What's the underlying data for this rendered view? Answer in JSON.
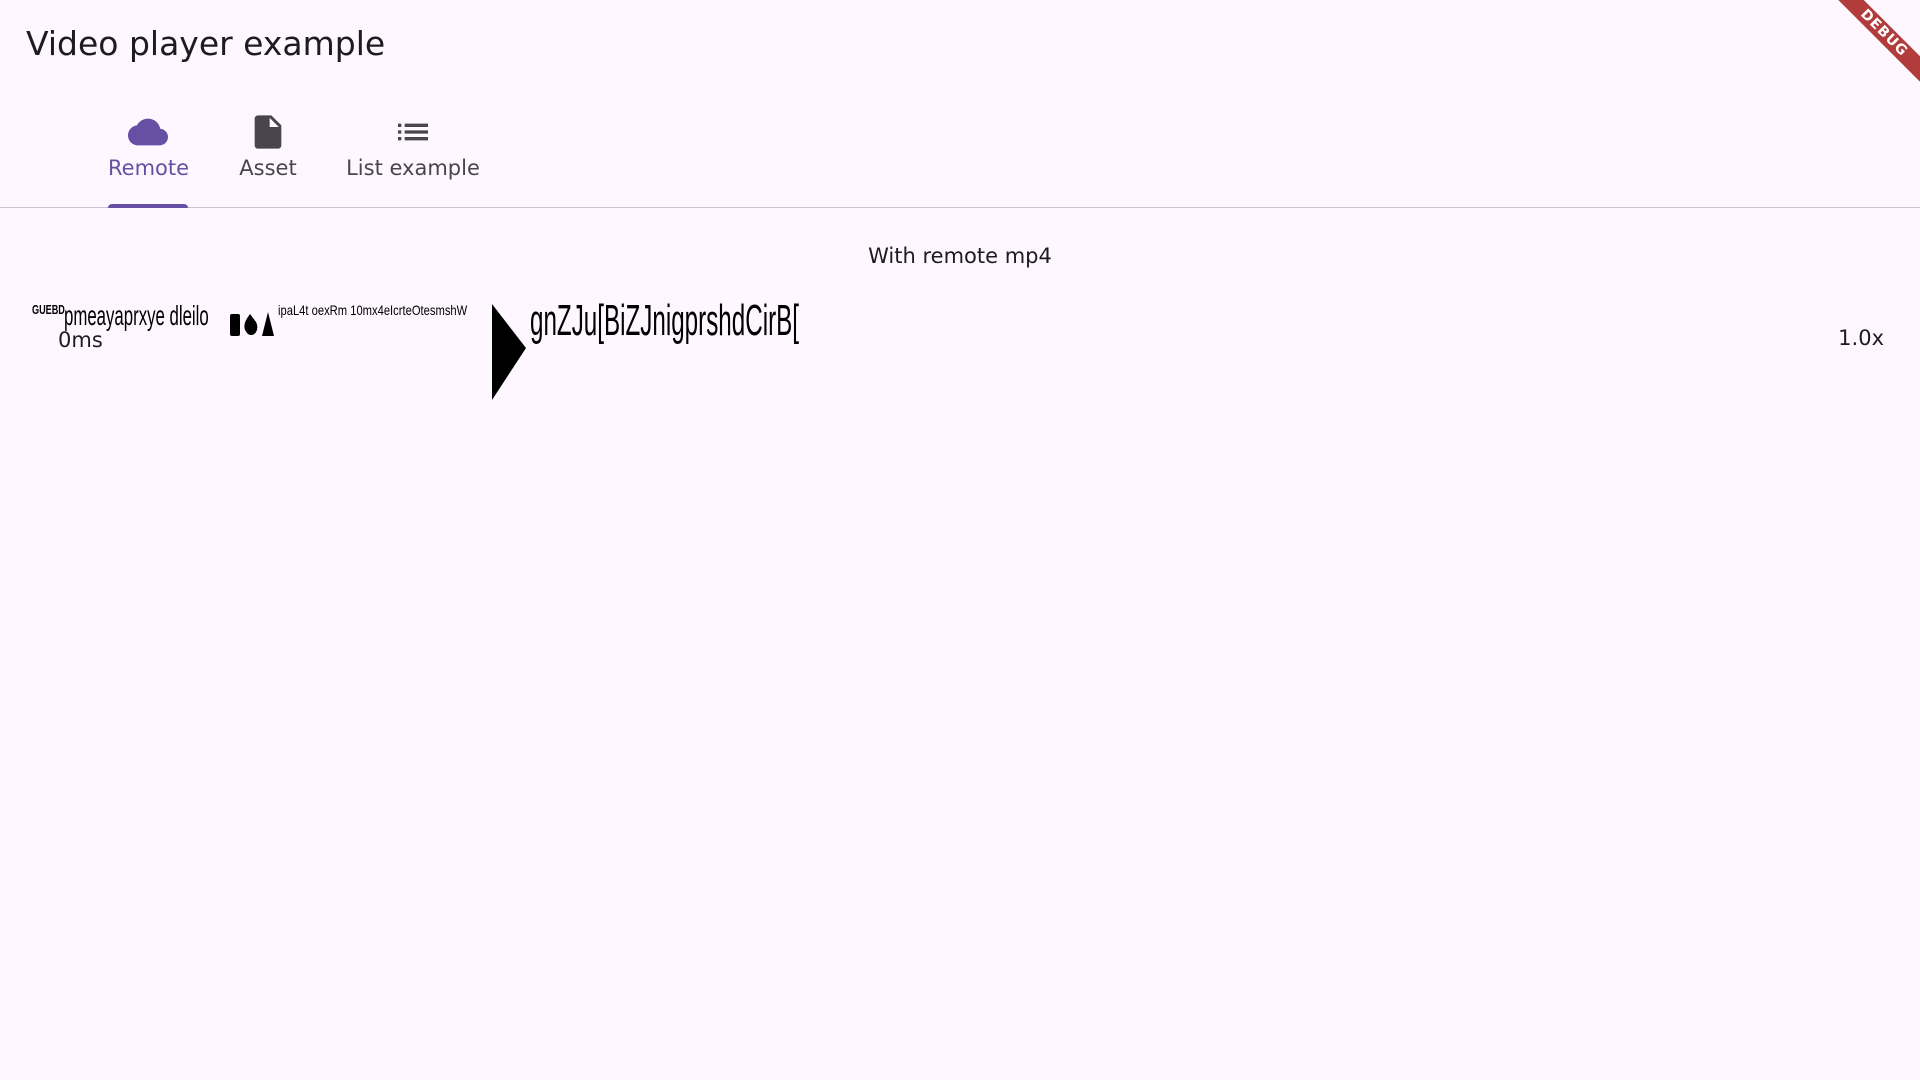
{
  "app": {
    "title": "Video player example",
    "debug_banner": "DEBUG"
  },
  "tabs": [
    {
      "label": "Remote",
      "icon": "cloud-icon",
      "active": true
    },
    {
      "label": "Asset",
      "icon": "file-icon",
      "active": false
    },
    {
      "label": "List example",
      "icon": "list-icon",
      "active": false
    }
  ],
  "colors": {
    "accent": "#6750a4",
    "background": "#fef7ff",
    "debug": "#b23b3b"
  },
  "remote": {
    "title": "With remote mp4",
    "position": "0ms",
    "speed": "1.0x",
    "play_icon": "play-arrow-icon",
    "garbled_text": [
      "GUEBD",
      "pmeayaprxye dleilo",
      "ipaL4t oexRm 10mx4eIcrteOtesmshW",
      "gnZJu[BiZJnigprshdCirB["
    ]
  }
}
